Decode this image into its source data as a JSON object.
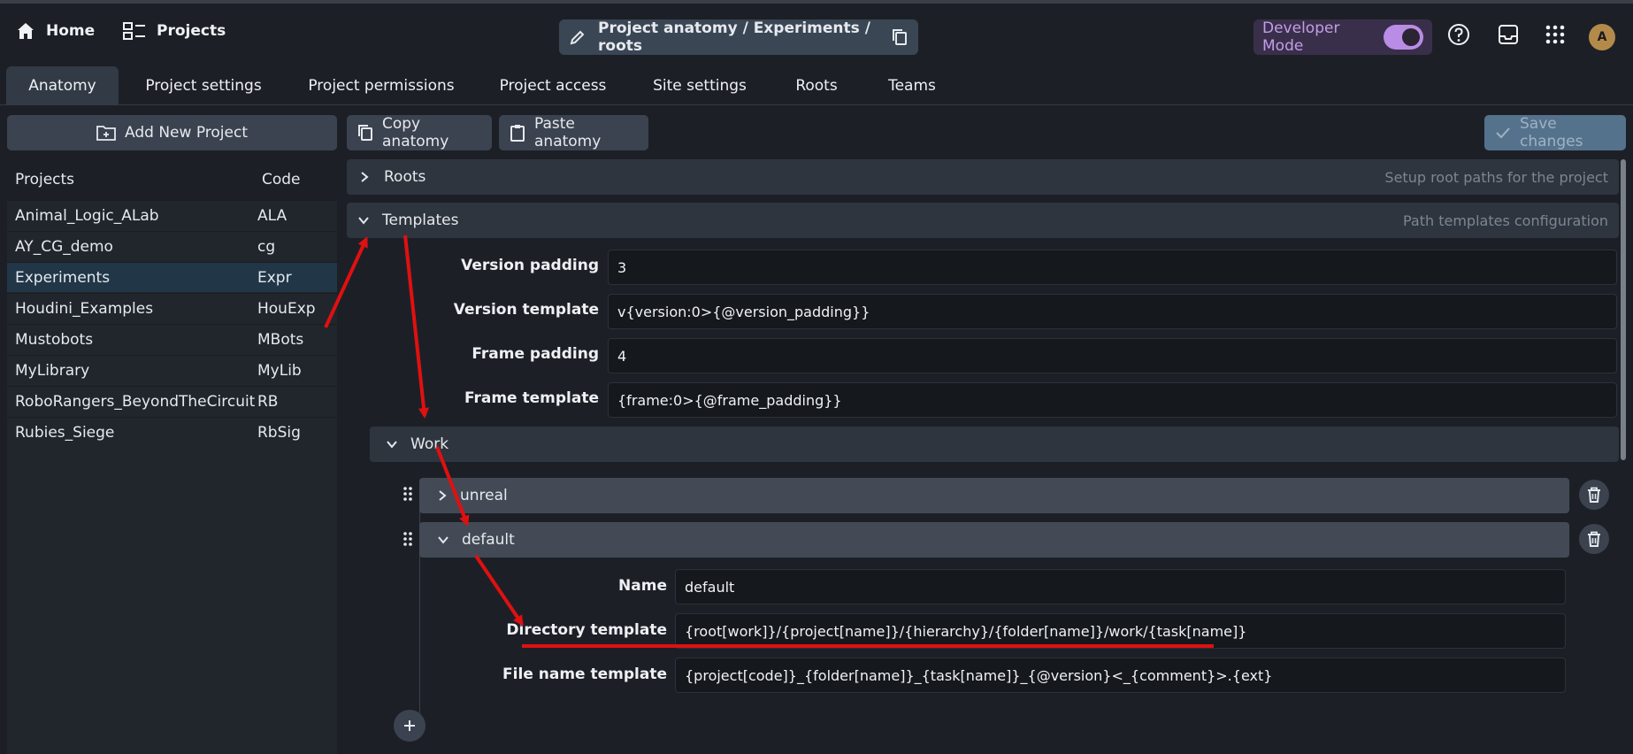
{
  "topbar": {
    "home_label": "Home",
    "projects_label": "Projects",
    "breadcrumb": "Project anatomy / Experiments / roots",
    "developer_mode_label": "Developer Mode",
    "developer_mode_on": true,
    "avatar_initial": "A"
  },
  "tabs": [
    "Anatomy",
    "Project settings",
    "Project permissions",
    "Project access",
    "Site settings",
    "Roots",
    "Teams"
  ],
  "active_tab": "Anatomy",
  "left": {
    "add_project_label": "Add New Project",
    "col_projects": "Projects",
    "col_code": "Code",
    "projects": [
      {
        "name": "Animal_Logic_ALab",
        "code": "ALA"
      },
      {
        "name": "AY_CG_demo",
        "code": "cg"
      },
      {
        "name": "Experiments",
        "code": "Expr"
      },
      {
        "name": "Houdini_Examples",
        "code": "HouExp"
      },
      {
        "name": "Mustobots",
        "code": "MBots"
      },
      {
        "name": "MyLibrary",
        "code": "MyLib"
      },
      {
        "name": "RoboRangers_BeyondTheCircuit",
        "code": "RB"
      },
      {
        "name": "Rubies_Siege",
        "code": "RbSig"
      }
    ],
    "selected_project": "Experiments"
  },
  "toolbar": {
    "copy_label": "Copy anatomy",
    "paste_label": "Paste anatomy",
    "save_label": "Save changes"
  },
  "sections": {
    "roots": {
      "title": "Roots",
      "hint": "Setup root paths for the project"
    },
    "templates": {
      "title": "Templates",
      "hint": "Path templates configuration"
    }
  },
  "templates": {
    "version_padding_label": "Version padding",
    "version_padding": "3",
    "version_template_label": "Version template",
    "version_template": "v{version:0>{@version_padding}}",
    "frame_padding_label": "Frame padding",
    "frame_padding": "4",
    "frame_template_label": "Frame template",
    "frame_template": "{frame:0>{@frame_padding}}"
  },
  "work": {
    "title": "Work",
    "items": [
      "unreal",
      "default"
    ],
    "default": {
      "name_label": "Name",
      "name": "default",
      "directory_label": "Directory template",
      "directory": "{root[work]}/{project[name]}/{hierarchy}/{folder[name]}/work/{task[name]}",
      "filename_label": "File name template",
      "filename": "{project[code]}_{folder[name]}_{task[name]}_{@version}<_{comment}>.{ext}"
    }
  },
  "colors": {
    "accent_purple": "#b98ce6",
    "selected_row": "#213748",
    "annotation_red": "#e01010"
  }
}
